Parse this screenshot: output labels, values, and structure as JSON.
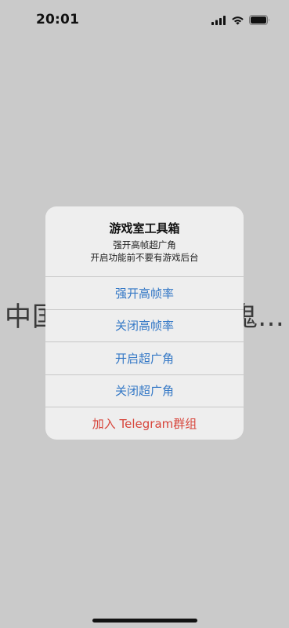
{
  "status_bar": {
    "time": "20:01",
    "icons": [
      "signal-icon",
      "wifi-icon",
      "battery-icon"
    ]
  },
  "background": {
    "text_left": "中国",
    "text_right": "鬼…"
  },
  "alert": {
    "title": "游戏室工具箱",
    "message_line1": "强开高帧超广角",
    "message_line2": "开启功能前不要有游戏后台",
    "buttons": [
      {
        "label": "强开高帧率"
      },
      {
        "label": "关闭高帧率"
      },
      {
        "label": "开启超广角"
      },
      {
        "label": "关闭超广角"
      },
      {
        "label": "加入 Telegram群组"
      }
    ],
    "colors": {
      "action": "#3478c6",
      "destructive": "#d7443a"
    }
  }
}
